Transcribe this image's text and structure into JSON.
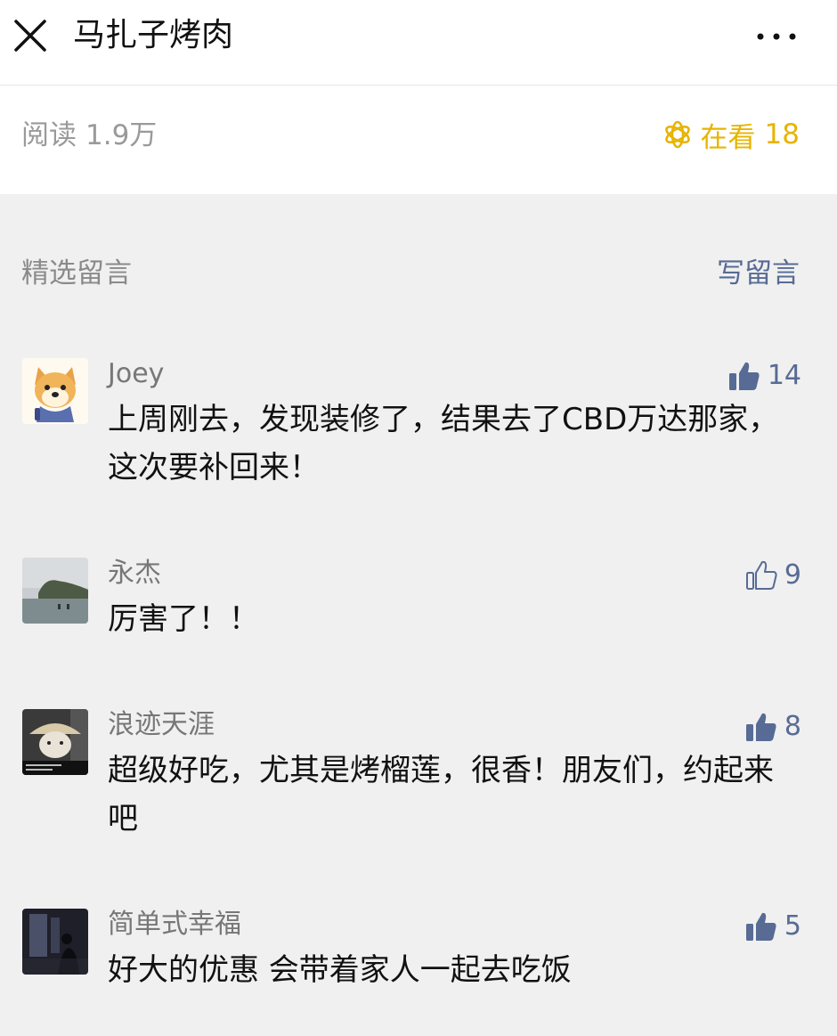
{
  "header": {
    "title": "马扎子烤肉"
  },
  "stats": {
    "read_label": "阅读",
    "read_count": "1.9万",
    "zaikan_label": "在看",
    "zaikan_count": "18"
  },
  "comments_section": {
    "title": "精选留言",
    "write_label": "写留言"
  },
  "comments": [
    {
      "nickname": "Joey",
      "likes": "14",
      "liked": true,
      "text": "上周刚去，发现装修了，结果去了CBD万达那家，这次要补回来！"
    },
    {
      "nickname": "永杰",
      "likes": "9",
      "liked": false,
      "text": "厉害了！！"
    },
    {
      "nickname": "浪迹天涯",
      "likes": "8",
      "liked": true,
      "text": "超级好吃，尤其是烤榴莲，很香！朋友们，约起来吧"
    },
    {
      "nickname": "简单式幸福",
      "likes": "5",
      "liked": true,
      "text": "好大的优惠 会带着家人一起去吃饭"
    }
  ],
  "colors": {
    "link": "#576b95",
    "zaikan": "#e7b400",
    "muted": "#9a9a9a"
  }
}
